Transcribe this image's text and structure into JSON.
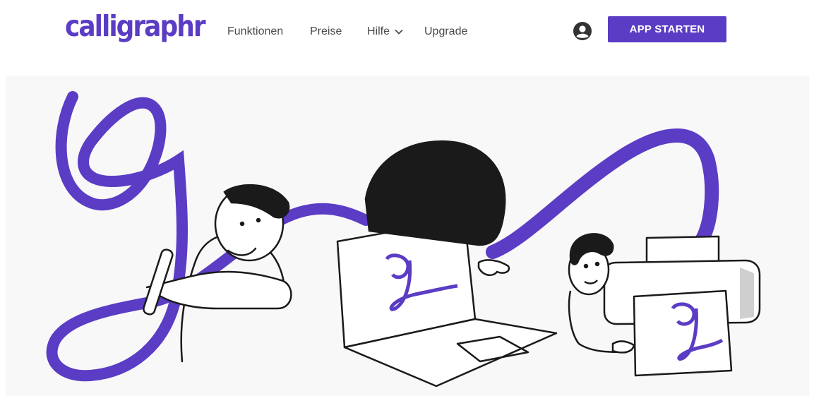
{
  "header": {
    "logo_text": "calligraphr",
    "nav": [
      {
        "label": "Funktionen"
      },
      {
        "label": "Preise"
      },
      {
        "label": "Hilfe"
      },
      {
        "label": "Upgrade"
      }
    ],
    "account_icon": "account-circle-icon",
    "cta_label": "APP STARTEN"
  },
  "hero": {
    "illustration": "hero-illustration",
    "accent_color": "#5b3cc4"
  },
  "colors": {
    "brand": "#5b3cc4",
    "nav_text": "#4a4a4a",
    "hero_bg": "#f8f8f8"
  }
}
